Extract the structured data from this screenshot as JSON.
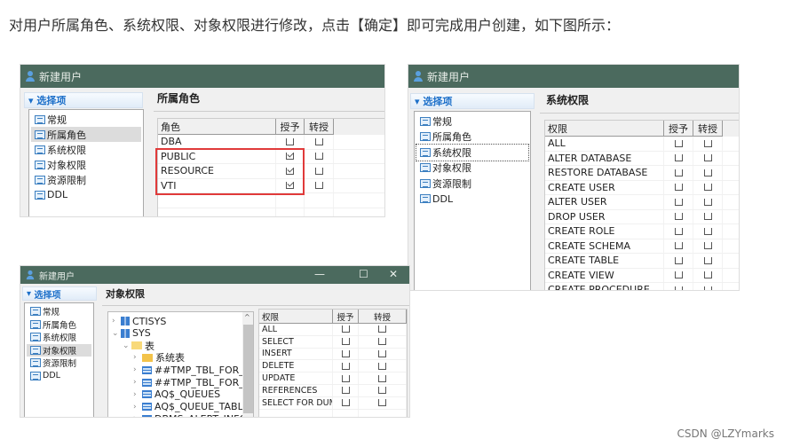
{
  "intro": "对用户所属角色、系统权限、对象权限进行修改，点击【确定】即可完成用户创建，如下图所示：",
  "window_title": "新建用户",
  "options_header": "选择项",
  "nav": [
    "常规",
    "所属角色",
    "系统权限",
    "对象权限",
    "资源限制",
    "DDL"
  ],
  "colors": {
    "titlebar": "#4b6a5e",
    "highlight": "#e03a3a",
    "accent": "#1c6fc9"
  },
  "shot1": {
    "section": "所属角色",
    "columns": [
      "角色",
      "授予",
      "转授"
    ],
    "selected_nav": 1,
    "rows": [
      {
        "name": "DBA",
        "grant": false,
        "regrant": false
      },
      {
        "name": "PUBLIC",
        "grant": true,
        "regrant": false
      },
      {
        "name": "RESOURCE",
        "grant": true,
        "regrant": false
      },
      {
        "name": "VTI",
        "grant": true,
        "regrant": false
      }
    ]
  },
  "shot2": {
    "section": "系统权限",
    "columns": [
      "权限",
      "授予",
      "转授"
    ],
    "selected_nav": 2,
    "rows": [
      "ALL",
      "ALTER DATABASE",
      "RESTORE DATABASE",
      "CREATE USER",
      "ALTER USER",
      "DROP USER",
      "CREATE ROLE",
      "CREATE SCHEMA",
      "CREATE TABLE",
      "CREATE VIEW",
      "CREATE PROCEDURE"
    ]
  },
  "shot3": {
    "section": "对象权限",
    "columns": [
      "权限",
      "授予",
      "转授"
    ],
    "selected_nav": 3,
    "window_controls": {
      "minimize": "—",
      "maximize": "☐",
      "close": "✕"
    },
    "tree": [
      {
        "label": "CTISYS",
        "level": 0,
        "icon": "schema-icon",
        "expanded": false
      },
      {
        "label": "SYS",
        "level": 0,
        "icon": "schema-icon",
        "expanded": true
      },
      {
        "label": "表",
        "level": 1,
        "icon": "folder-open-icon",
        "expanded": true
      },
      {
        "label": "系统表",
        "level": 2,
        "icon": "folder-icon",
        "expanded": false
      },
      {
        "label": "##TMP_TBL_FOR_DBMS",
        "level": 2,
        "icon": "table-icon",
        "expanded": false
      },
      {
        "label": "##TMP_TBL_FOR_DBMS",
        "level": 2,
        "icon": "table-icon",
        "expanded": false
      },
      {
        "label": "AQ$_QUEUES",
        "level": 2,
        "icon": "table-icon",
        "expanded": false
      },
      {
        "label": "AQ$_QUEUE_TABLES",
        "level": 2,
        "icon": "table-icon",
        "expanded": false
      },
      {
        "label": "DBMS_ALERT_INFO",
        "level": 2,
        "icon": "table-icon",
        "expanded": false
      }
    ],
    "rows": [
      "ALL",
      "SELECT",
      "INSERT",
      "DELETE",
      "UPDATE",
      "REFERENCES",
      "SELECT FOR DUM..."
    ]
  },
  "watermark": "CSDN @LZYmarks"
}
